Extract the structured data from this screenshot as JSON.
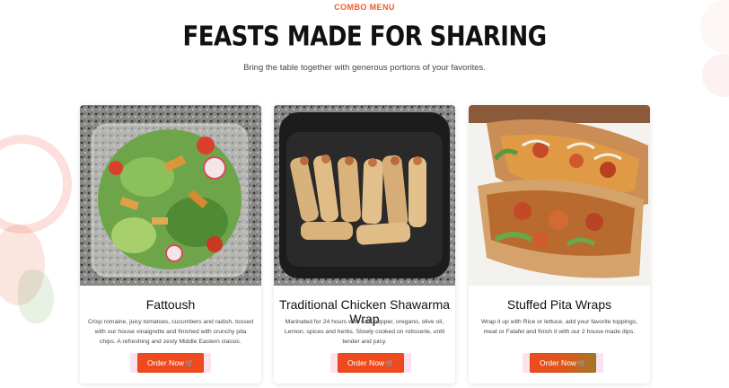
{
  "header": {
    "eyebrow": "COMBO MENU",
    "title": "FEASTS MADE FOR SHARING",
    "subtitle": "Bring the table together with generous portions of your favorites."
  },
  "cards": [
    {
      "title": "Fattoush",
      "description": "Crisp romaine, juicy tomatoes, cucumbers and radish, tossed with our house vinaigrette and finished with crunchy pita chips. A refreshing and zesty Middle Eastern classic.",
      "button_label": "Order Now",
      "image": "fattoush-salad-photo"
    },
    {
      "title": "Traditional Chicken Shawarma Wrap",
      "description": "Marinated for 24 hours with salt, pepper, oregano, olive oil, Lemon, spices and herbs. Slowly cooked on rotisserie, until tender and juicy.",
      "button_label": "Order Now",
      "image": "shawarma-wraps-photo"
    },
    {
      "title": "Stuffed Pita Wraps",
      "description": "Wrap it up with Rice or lettuce, add your favorite toppings, meat or Falafel and finish it with our 2 house made dips.",
      "button_label": "Order Now",
      "image": "stuffed-pita-photo"
    }
  ],
  "icons": {
    "cart": "shopping-cart-icon"
  },
  "colors": {
    "accent": "#f15a24",
    "button": "#ef4a1e",
    "title": "#111111"
  }
}
